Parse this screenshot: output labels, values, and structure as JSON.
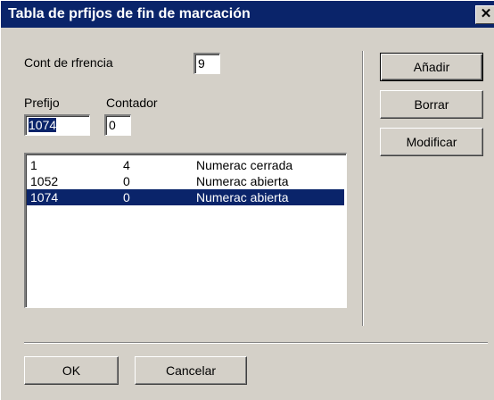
{
  "window": {
    "title": "Tabla de prfijos de fin de marcación",
    "close_glyph": "✕"
  },
  "ref_counter": {
    "label": "Cont de rfrencia",
    "value": "9"
  },
  "prefix": {
    "label": "Prefijo",
    "value": "1074"
  },
  "counter": {
    "label": "Contador",
    "value": "0"
  },
  "list": {
    "rows": [
      {
        "prefix": "1",
        "count": "4",
        "type": "Numerac cerrada",
        "selected": false
      },
      {
        "prefix": "1052",
        "count": "0",
        "type": "Numerac abierta",
        "selected": false
      },
      {
        "prefix": "1074",
        "count": "0",
        "type": "Numerac abierta",
        "selected": true
      }
    ]
  },
  "buttons": {
    "add": "Añadir",
    "delete": "Borrar",
    "modify": "Modificar",
    "ok": "OK",
    "cancel": "Cancelar"
  },
  "colors": {
    "title_bar": "#0a246a",
    "selection": "#0a246a",
    "face": "#d4d0c8"
  }
}
